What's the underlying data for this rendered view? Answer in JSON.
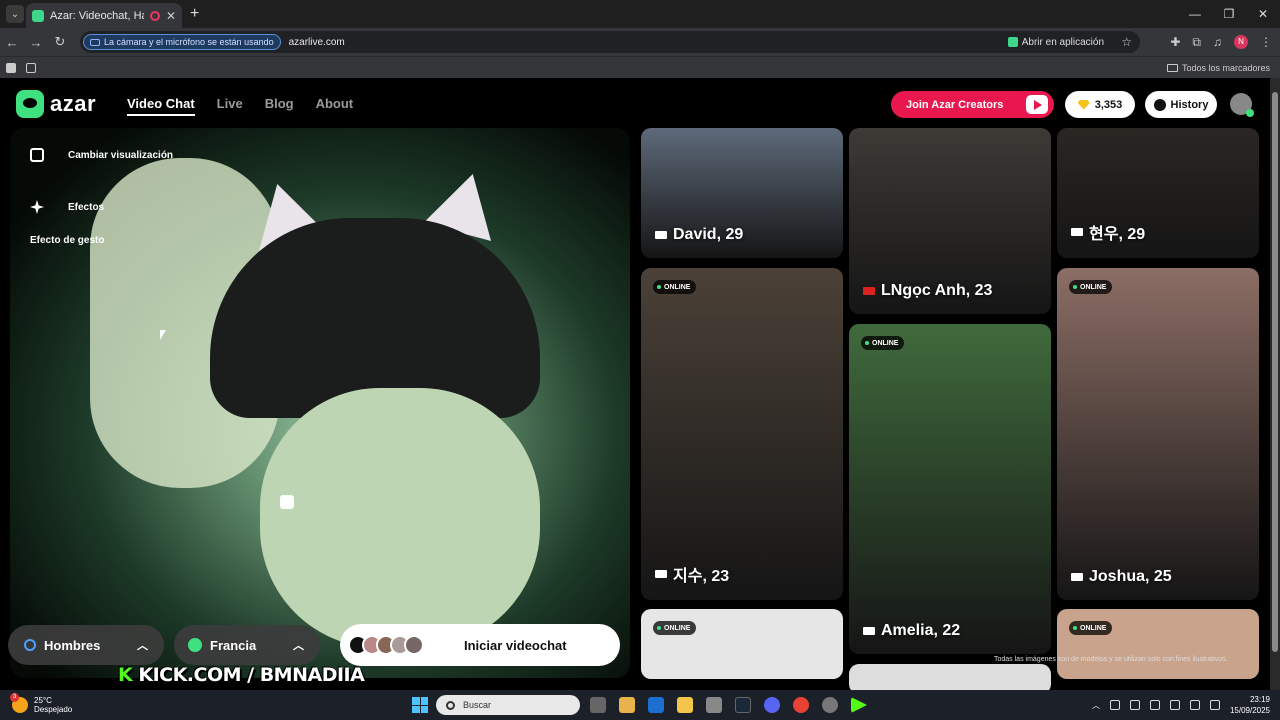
{
  "browser": {
    "tab_title": "Azar: Videochat, Haz nuevo",
    "camera_notice": "La cámara y el micrófono se están usando",
    "url": "azarlive.com",
    "open_in_app": "Abrir en aplicación",
    "profile_initial": "N",
    "all_bookmarks": "Todos los marcadores"
  },
  "site": {
    "logo": "azar",
    "nav": [
      "Video Chat",
      "Live",
      "Blog",
      "About"
    ],
    "join_label": "Join Azar Creators",
    "gems": "3,353",
    "history_label": "History"
  },
  "video": {
    "tools": [
      "Cambiar visualización",
      "Efectos",
      "Efecto de gesto"
    ],
    "gender_filter": "Hombres",
    "country_filter": "Francia",
    "start_label": "Iniciar videochat",
    "overlay_k": "K",
    "overlay_text": " KICK.COM / BMNADIIA"
  },
  "gallery": {
    "online_label": "ONLINE",
    "cards": [
      {
        "name": "David, 29",
        "color": "#5e6a7a"
      },
      {
        "name": "LNgọc Anh, 23",
        "color": "#3d3a36"
      },
      {
        "name": "현우, 29",
        "color": "#2a2623"
      },
      {
        "name": "지수, 23",
        "color": "#4b4138"
      },
      {
        "name": "Amelia, 22",
        "color": "#3f6a3c"
      },
      {
        "name": "Joshua, 25",
        "color": "#8c6e65"
      }
    ],
    "disclaimer": "Todas las imágenes son de modelos y se utilizan solo con fines ilustrativos."
  },
  "taskbar": {
    "temp": "25°C",
    "weather": "Despejado",
    "weather_badge": "3",
    "search_placeholder": "Buscar",
    "time": "23:19",
    "date": "15/09/2025"
  }
}
